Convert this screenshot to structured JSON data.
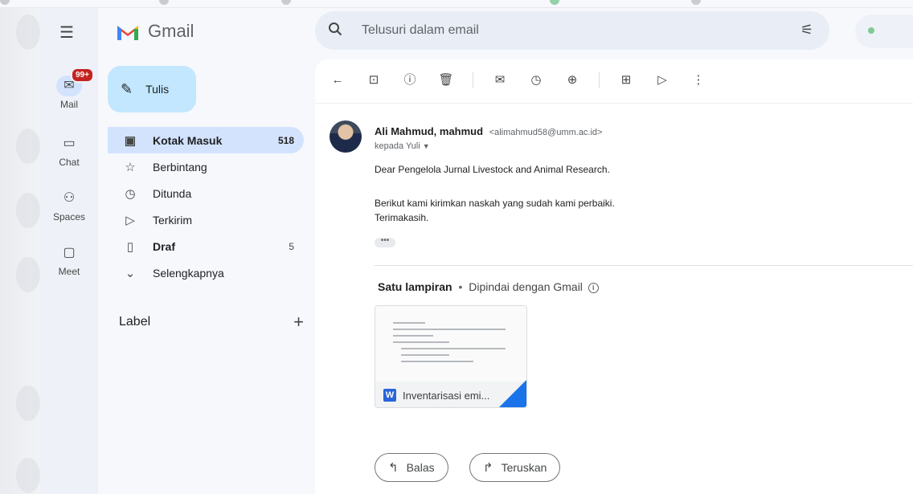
{
  "top_strip": {},
  "rail": {
    "mail": {
      "label": "Mail",
      "badge": "99+"
    },
    "chat": {
      "label": "Chat"
    },
    "spaces": {
      "label": "Spaces"
    },
    "meet": {
      "label": "Meet"
    }
  },
  "app": {
    "name": "Gmail"
  },
  "compose": {
    "label": "Tulis"
  },
  "nav": {
    "items": [
      {
        "label": "Kotak Masuk",
        "count": "518",
        "icon": "inbox-icon",
        "active": true
      },
      {
        "label": "Berbintang",
        "count": "",
        "icon": "star-icon"
      },
      {
        "label": "Ditunda",
        "count": "",
        "icon": "clock-icon"
      },
      {
        "label": "Terkirim",
        "count": "",
        "icon": "send-icon"
      },
      {
        "label": "Draf",
        "count": "5",
        "icon": "file-icon"
      },
      {
        "label": "Selengkapnya",
        "count": "",
        "icon": "chevron-down-icon"
      }
    ]
  },
  "labels": {
    "title": "Label"
  },
  "search": {
    "placeholder": "Telusuri dalam email"
  },
  "toolbar": {
    "icons": [
      "back-icon",
      "archive-icon",
      "report-spam-icon",
      "delete-icon",
      "mark-unread-icon",
      "snooze-icon",
      "add-task-icon",
      "move-to-icon",
      "label-icon",
      "more-icon"
    ]
  },
  "email": {
    "sender_name": "Ali Mahmud, mahmud",
    "sender_email": "<alimahmud58@umm.ac.id>",
    "to": "kepada Yuli",
    "greeting": "Dear Pengelola Jurnal Livestock and Animal Research.",
    "line1": "Berikut kami kirimkan naskah yang sudah kami perbaiki.",
    "line2": "Terimakasih."
  },
  "attachments": {
    "title": "Satu lampiran",
    "scan_text": "Dipindai dengan Gmail",
    "file_name": "Inventarisasi emi..."
  },
  "actions": {
    "reply": "Balas",
    "forward": "Teruskan"
  },
  "colors": {
    "accent": "#d3e3fd",
    "compose": "#c2e7ff",
    "badge": "#c5221f",
    "word": "#2a65d8"
  }
}
